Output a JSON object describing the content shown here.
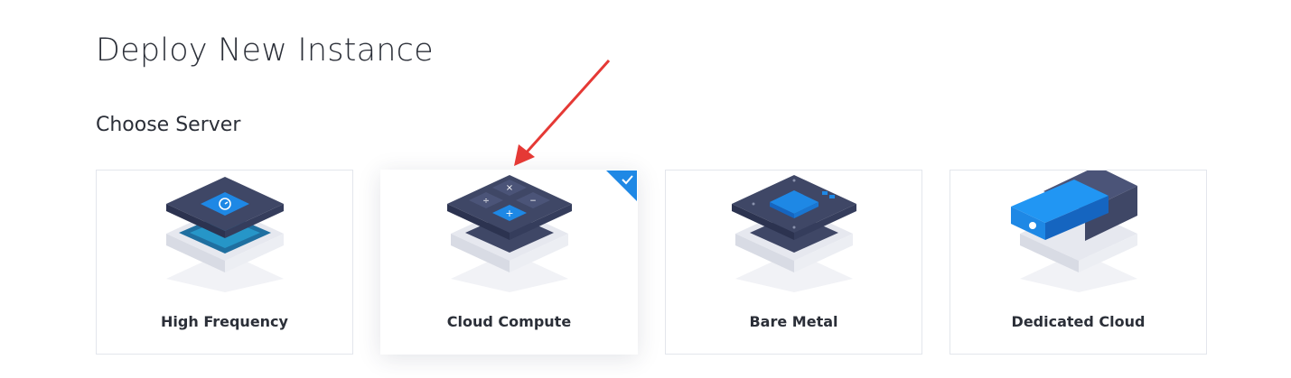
{
  "page": {
    "title": "Deploy New Instance"
  },
  "section": {
    "title": "Choose Server"
  },
  "servers": [
    {
      "label": "High Frequency",
      "icon": "high-frequency-server-icon",
      "selected": false
    },
    {
      "label": "Cloud Compute",
      "icon": "cloud-compute-server-icon",
      "selected": true
    },
    {
      "label": "Bare Metal",
      "icon": "bare-metal-server-icon",
      "selected": false
    },
    {
      "label": "Dedicated Cloud",
      "icon": "dedicated-cloud-server-icon",
      "selected": false
    }
  ],
  "colors": {
    "accent": "#1e88e5",
    "annotation_arrow": "#e53935",
    "dark_panel": "#3f4766",
    "card_border": "#e3e6ec"
  }
}
